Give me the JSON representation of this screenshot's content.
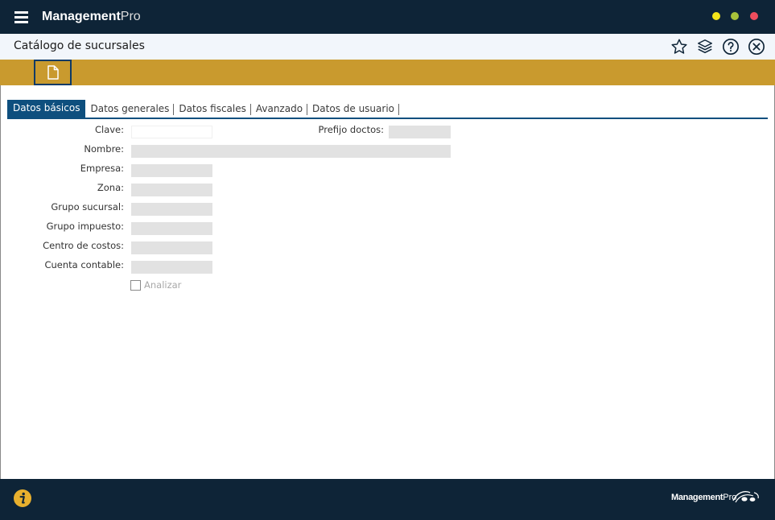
{
  "app": {
    "brand_bold": "Management",
    "brand_light": "Pro"
  },
  "header": {
    "page_title": "Catálogo de sucursales"
  },
  "tabs": [
    {
      "label": "Datos básicos"
    },
    {
      "label": "Datos generales"
    },
    {
      "label": "Datos fiscales"
    },
    {
      "label": "Avanzado"
    },
    {
      "label": "Datos de usuario"
    }
  ],
  "form": {
    "clave": {
      "label": "Clave:",
      "value": ""
    },
    "prefijo": {
      "label": "Prefijo doctos:",
      "value": ""
    },
    "nombre": {
      "label": "Nombre:",
      "value": ""
    },
    "empresa": {
      "label": "Empresa:",
      "value": ""
    },
    "zona": {
      "label": "Zona:",
      "value": ""
    },
    "grupo_sucursal": {
      "label": "Grupo sucursal:",
      "value": ""
    },
    "grupo_impuesto": {
      "label": "Grupo impuesto:",
      "value": ""
    },
    "centro_costos": {
      "label": "Centro de costos:",
      "value": ""
    },
    "cuenta_contable": {
      "label": "Cuenta contable:",
      "value": ""
    },
    "analizar": {
      "label": "Analizar",
      "checked": false
    }
  },
  "footer": {
    "brand_bold": "Management",
    "brand_light": "Pro"
  },
  "colors": {
    "topbar": "#0e2437",
    "toolbar": "#c99a2e",
    "tab_active": "#0e4f7e",
    "field_disabled": "#e2e2e2",
    "window_yellow": "#f4e51a",
    "window_green": "#a8c23a",
    "window_red": "#ef4d5d"
  }
}
